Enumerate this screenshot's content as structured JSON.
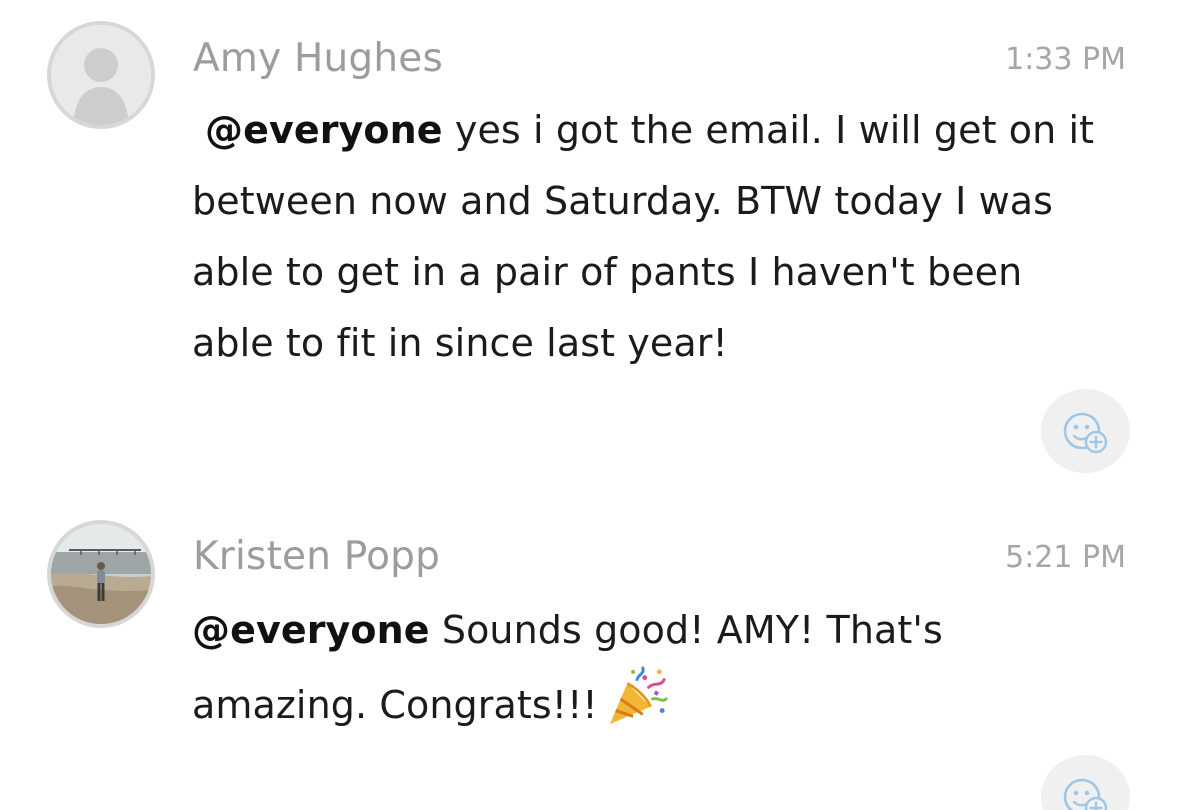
{
  "messages": [
    {
      "author": "Amy Hughes",
      "time": "1:33 PM",
      "mention": "@everyone",
      "text": " yes i got the email.  I will get on it between now and Saturday.  BTW today I was able to get in a pair of pants I haven't been able to fit in since last year!",
      "avatar": "default-person-avatar",
      "reaction_icon": "add-reaction-icon"
    },
    {
      "author": "Kristen Popp",
      "time": "5:21 PM",
      "mention": "@everyone",
      "text": " Sounds good! AMY! That's amazing. Congrats!!!",
      "emoji": "party-popper-icon",
      "avatar": "beach-photo-avatar",
      "reaction_icon": "add-reaction-icon"
    }
  ],
  "colors": {
    "author": "#9c9c9c",
    "time": "#a6a6a6",
    "body": "#1b1b1b",
    "reaction_bg": "#f0f0f0",
    "reaction_icon": "#9fc6e6"
  }
}
